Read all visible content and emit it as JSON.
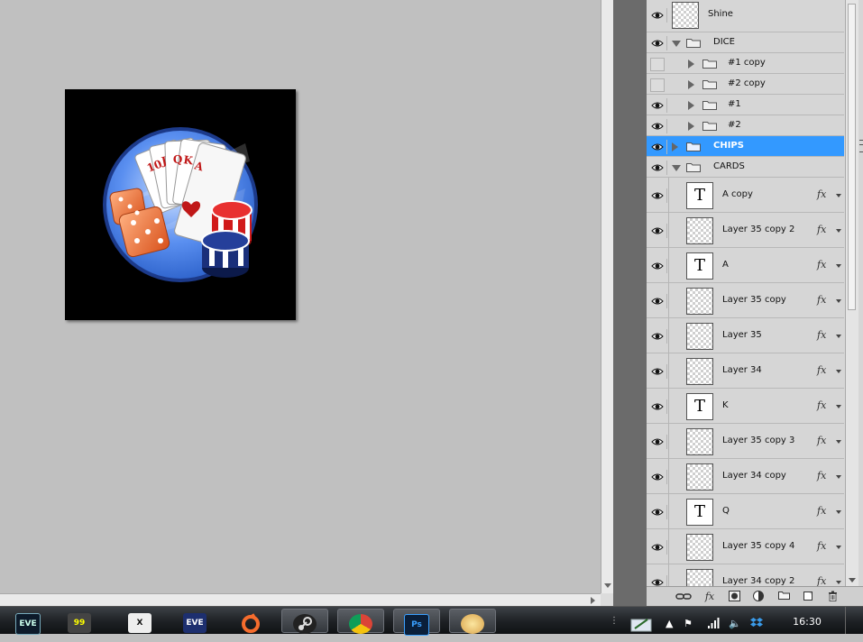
{
  "layers": [
    {
      "id": "shine",
      "name": "Shine",
      "kind": "pixel",
      "visible": true,
      "indent": 0
    },
    {
      "id": "dice",
      "name": "DICE",
      "kind": "group",
      "expanded": true,
      "visible": true,
      "indent": 0
    },
    {
      "id": "one-copy",
      "name": "#1 copy",
      "kind": "group",
      "expanded": false,
      "visible": false,
      "indent": 1
    },
    {
      "id": "two-copy",
      "name": "#2 copy",
      "kind": "group",
      "expanded": false,
      "visible": false,
      "indent": 1
    },
    {
      "id": "one",
      "name": "#1",
      "kind": "group",
      "expanded": false,
      "visible": true,
      "indent": 1
    },
    {
      "id": "two",
      "name": "#2",
      "kind": "group",
      "expanded": false,
      "visible": true,
      "indent": 1
    },
    {
      "id": "chips",
      "name": "CHIPS",
      "kind": "group",
      "expanded": false,
      "visible": true,
      "indent": 0,
      "selected": true
    },
    {
      "id": "cards",
      "name": "CARDS",
      "kind": "group",
      "expanded": true,
      "visible": true,
      "indent": 0
    },
    {
      "id": "a-copy",
      "name": "A copy",
      "kind": "text",
      "fx": true,
      "visible": true,
      "indent": 1,
      "thumb_letter": "T"
    },
    {
      "id": "l35c2",
      "name": "Layer 35 copy 2",
      "kind": "pixel",
      "fx": true,
      "visible": true,
      "indent": 1
    },
    {
      "id": "a",
      "name": "A",
      "kind": "text",
      "fx": true,
      "visible": true,
      "indent": 1,
      "thumb_letter": "T"
    },
    {
      "id": "l35c",
      "name": "Layer 35 copy",
      "kind": "pixel",
      "fx": true,
      "visible": true,
      "indent": 1
    },
    {
      "id": "l35",
      "name": "Layer 35",
      "kind": "pixel",
      "fx": true,
      "visible": true,
      "indent": 1
    },
    {
      "id": "l34",
      "name": "Layer 34",
      "kind": "pixel",
      "fx": true,
      "visible": true,
      "indent": 1
    },
    {
      "id": "k",
      "name": "K",
      "kind": "text",
      "fx": true,
      "visible": true,
      "indent": 1,
      "thumb_letter": "T"
    },
    {
      "id": "l35c3",
      "name": "Layer 35 copy 3",
      "kind": "pixel",
      "fx": true,
      "visible": true,
      "indent": 1
    },
    {
      "id": "l34c",
      "name": "Layer 34 copy",
      "kind": "pixel",
      "fx": true,
      "visible": true,
      "indent": 1
    },
    {
      "id": "q",
      "name": "Q",
      "kind": "text",
      "fx": true,
      "visible": true,
      "indent": 1,
      "thumb_letter": "T"
    },
    {
      "id": "l35c4",
      "name": "Layer 35 copy 4",
      "kind": "pixel",
      "fx": true,
      "visible": true,
      "indent": 1
    },
    {
      "id": "l34c2",
      "name": "Layer 34 copy 2",
      "kind": "pixel",
      "fx": true,
      "visible": true,
      "indent": 1
    }
  ],
  "layers_footer": {
    "icons": [
      "link-icon",
      "fx-icon",
      "mask-icon",
      "adjustment-icon",
      "group-folder-icon",
      "new-layer-icon",
      "trash-icon"
    ],
    "fx_label": "fx"
  },
  "artwork": {
    "card_ranks": [
      "10",
      "J",
      "Q",
      "K",
      "A"
    ],
    "colors": {
      "background": "#000000",
      "circle": "#4d84e8",
      "red_chip": "#d11a1a",
      "blue_chip": "#1a2f7a",
      "dice": "#e66a2c",
      "suit": "#c01818"
    }
  },
  "taskbar": {
    "apps": [
      {
        "name": "eve-icon",
        "label": "EVE",
        "boxed": false
      },
      {
        "name": "badge-app-icon",
        "label": "99",
        "boxed": false
      },
      {
        "name": "x-app-icon",
        "label": "X",
        "boxed": false
      },
      {
        "name": "eve-online-icon",
        "label": "EVE",
        "boxed": false
      },
      {
        "name": "origin-icon",
        "label": "",
        "boxed": false
      },
      {
        "name": "steam-icon",
        "label": "",
        "boxed": true
      },
      {
        "name": "chrome-icon",
        "label": "",
        "boxed": true
      },
      {
        "name": "photoshop-icon",
        "label": "Ps",
        "boxed": true
      },
      {
        "name": "paint-icon",
        "label": "",
        "boxed": true
      }
    ],
    "clock": "16:30"
  }
}
